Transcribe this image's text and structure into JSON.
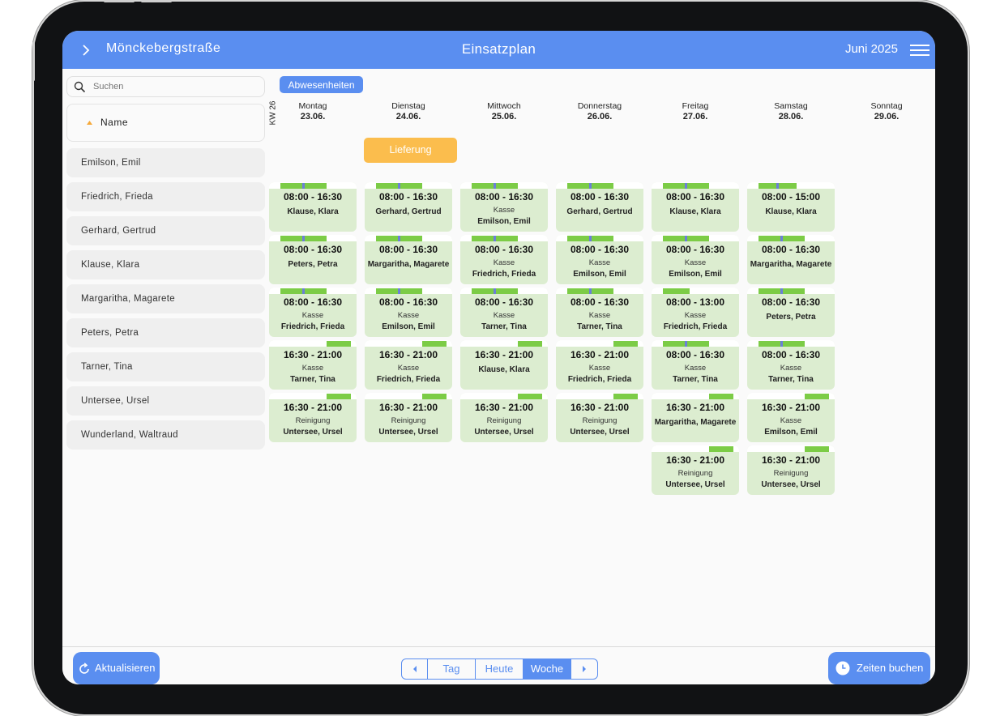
{
  "header": {
    "store": "Mönckebergstraße",
    "title": "Einsatzplan",
    "month": "Juni 2025"
  },
  "sidebar": {
    "search_placeholder": "Suchen",
    "name_header": "Name",
    "employees": [
      "Emilson, Emil",
      "Friedrich, Frieda",
      "Gerhard, Gertrud",
      "Klause, Klara",
      "Margaritha, Magarete",
      "Peters, Petra",
      "Tarner, Tina",
      "Untersee, Ursel",
      "Wunderland, Waltraud"
    ]
  },
  "calendar": {
    "absences_label": "Abwesenheiten",
    "week_label": "KW 26",
    "days": [
      {
        "name": "Montag",
        "date": "23.06."
      },
      {
        "name": "Dienstag",
        "date": "24.06."
      },
      {
        "name": "Mittwoch",
        "date": "25.06."
      },
      {
        "name": "Donnerstag",
        "date": "26.06."
      },
      {
        "name": "Freitag",
        "date": "27.06."
      },
      {
        "name": "Samstag",
        "date": "28.06."
      },
      {
        "name": "Sonntag",
        "date": "29.06."
      }
    ],
    "delivery_label": "Lieferung",
    "shifts": [
      [
        {
          "time": "08:00 - 16:30",
          "role": "",
          "employee": "Klause, Klara"
        },
        {
          "time": "08:00 - 16:30",
          "role": "",
          "employee": "Peters, Petra"
        },
        {
          "time": "08:00 - 16:30",
          "role": "Kasse",
          "employee": "Friedrich, Frieda"
        },
        {
          "time": "16:30 - 21:00",
          "role": "Kasse",
          "employee": "Tarner, Tina"
        },
        {
          "time": "16:30 - 21:00",
          "role": "Reinigung",
          "employee": "Untersee, Ursel"
        }
      ],
      [
        {
          "time": "08:00 - 16:30",
          "role": "",
          "employee": "Gerhard, Gertrud"
        },
        {
          "time": "08:00 - 16:30",
          "role": "",
          "employee": "Margaritha, Magarete"
        },
        {
          "time": "08:00 - 16:30",
          "role": "Kasse",
          "employee": "Emilson, Emil"
        },
        {
          "time": "16:30 - 21:00",
          "role": "Kasse",
          "employee": "Friedrich, Frieda"
        },
        {
          "time": "16:30 - 21:00",
          "role": "Reinigung",
          "employee": "Untersee, Ursel"
        }
      ],
      [
        {
          "time": "08:00 - 16:30",
          "role": "Kasse",
          "employee": "Emilson, Emil"
        },
        {
          "time": "08:00 - 16:30",
          "role": "Kasse",
          "employee": "Friedrich, Frieda"
        },
        {
          "time": "08:00 - 16:30",
          "role": "Kasse",
          "employee": "Tarner, Tina"
        },
        {
          "time": "16:30 - 21:00",
          "role": "",
          "employee": "Klause, Klara"
        },
        {
          "time": "16:30 - 21:00",
          "role": "Reinigung",
          "employee": "Untersee, Ursel"
        }
      ],
      [
        {
          "time": "08:00 - 16:30",
          "role": "",
          "employee": "Gerhard, Gertrud"
        },
        {
          "time": "08:00 - 16:30",
          "role": "Kasse",
          "employee": "Emilson, Emil"
        },
        {
          "time": "08:00 - 16:30",
          "role": "Kasse",
          "employee": "Tarner, Tina"
        },
        {
          "time": "16:30 - 21:00",
          "role": "Kasse",
          "employee": "Friedrich, Frieda"
        },
        {
          "time": "16:30 - 21:00",
          "role": "Reinigung",
          "employee": "Untersee, Ursel"
        }
      ],
      [
        {
          "time": "08:00 - 16:30",
          "role": "",
          "employee": "Klause, Klara"
        },
        {
          "time": "08:00 - 16:30",
          "role": "Kasse",
          "employee": "Emilson, Emil"
        },
        {
          "time": "08:00 - 13:00",
          "role": "Kasse",
          "employee": "Friedrich, Frieda"
        },
        {
          "time": "08:00 - 16:30",
          "role": "Kasse",
          "employee": "Tarner, Tina"
        },
        {
          "time": "16:30 - 21:00",
          "role": "",
          "employee": "Margaritha, Magarete"
        },
        {
          "time": "16:30 - 21:00",
          "role": "Reinigung",
          "employee": "Untersee, Ursel"
        }
      ],
      [
        {
          "time": "08:00 - 15:00",
          "role": "",
          "employee": "Klause, Klara"
        },
        {
          "time": "08:00 - 16:30",
          "role": "",
          "employee": "Margaritha, Magarete"
        },
        {
          "time": "08:00 - 16:30",
          "role": "",
          "employee": "Peters, Petra"
        },
        {
          "time": "08:00 - 16:30",
          "role": "Kasse",
          "employee": "Tarner, Tina"
        },
        {
          "time": "16:30 - 21:00",
          "role": "Kasse",
          "employee": "Emilson, Emil"
        },
        {
          "time": "16:30 - 21:00",
          "role": "Reinigung",
          "employee": "Untersee, Ursel"
        }
      ],
      []
    ]
  },
  "footer": {
    "refresh_label": "Aktualisieren",
    "view_options": [
      "Tag",
      "Heute",
      "Woche"
    ],
    "active_view": "Woche",
    "book_label": "Zeiten buchen"
  },
  "colors": {
    "accent": "#5a8ef0",
    "delivery": "#fbbd4d",
    "shift_bg": "#dcedd0",
    "shift_bar": "#7ccc46",
    "break_mark": "#6b7fd8"
  },
  "icons": {
    "header_left": "chevron-right-icon",
    "header_right": "hamburger-menu-icon",
    "search": "search-icon",
    "sort": "sort-ascending-icon",
    "refresh": "refresh-icon",
    "prev": "caret-left-icon",
    "next": "caret-right-icon",
    "book": "clock-icon"
  }
}
